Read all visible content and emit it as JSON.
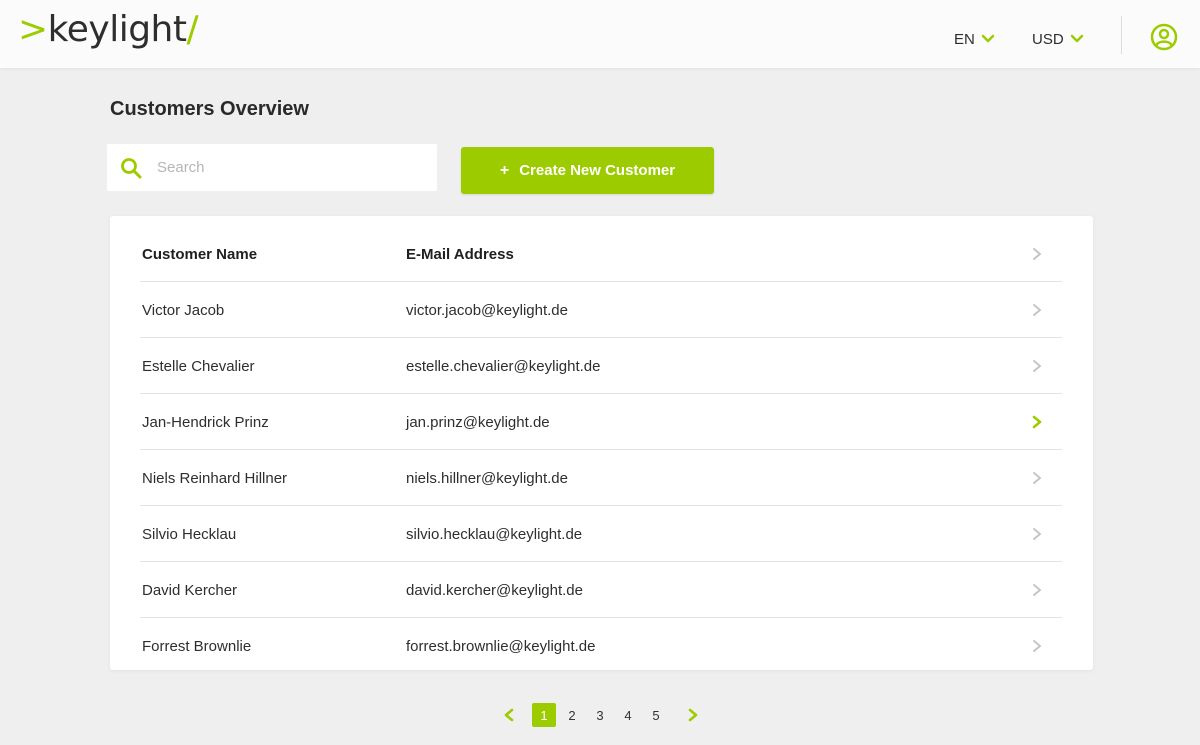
{
  "brand": {
    "logo_prefix": ">",
    "logo_text": "keylight",
    "logo_suffix": "/",
    "accent_color": "#9ccc00"
  },
  "header": {
    "language": "EN",
    "currency": "USD",
    "user_icon": "user-circle-icon"
  },
  "page": {
    "title": "Customers Overview"
  },
  "search": {
    "placeholder": "Search",
    "value": ""
  },
  "actions": {
    "create_plus": "+",
    "create_label": "Create New Customer"
  },
  "table": {
    "columns": [
      "Customer Name",
      "E-Mail Address"
    ],
    "rows": [
      {
        "name": "Victor Jacob",
        "email": "victor.jacob@keylight.de",
        "highlighted": false
      },
      {
        "name": "Estelle Chevalier",
        "email": "estelle.chevalier@keylight.de",
        "highlighted": false
      },
      {
        "name": "Jan-Hendrick Prinz",
        "email": "jan.prinz@keylight.de",
        "highlighted": true
      },
      {
        "name": "Niels Reinhard Hillner",
        "email": "niels.hillner@keylight.de",
        "highlighted": false
      },
      {
        "name": "Silvio Hecklau",
        "email": "silvio.hecklau@keylight.de",
        "highlighted": false
      },
      {
        "name": "David Kercher",
        "email": "david.kercher@keylight.de",
        "highlighted": false
      },
      {
        "name": "Forrest Brownlie",
        "email": "forrest.brownlie@keylight.de",
        "highlighted": false
      }
    ]
  },
  "pagination": {
    "pages": [
      "1",
      "2",
      "3",
      "4",
      "5"
    ],
    "current": "1"
  }
}
